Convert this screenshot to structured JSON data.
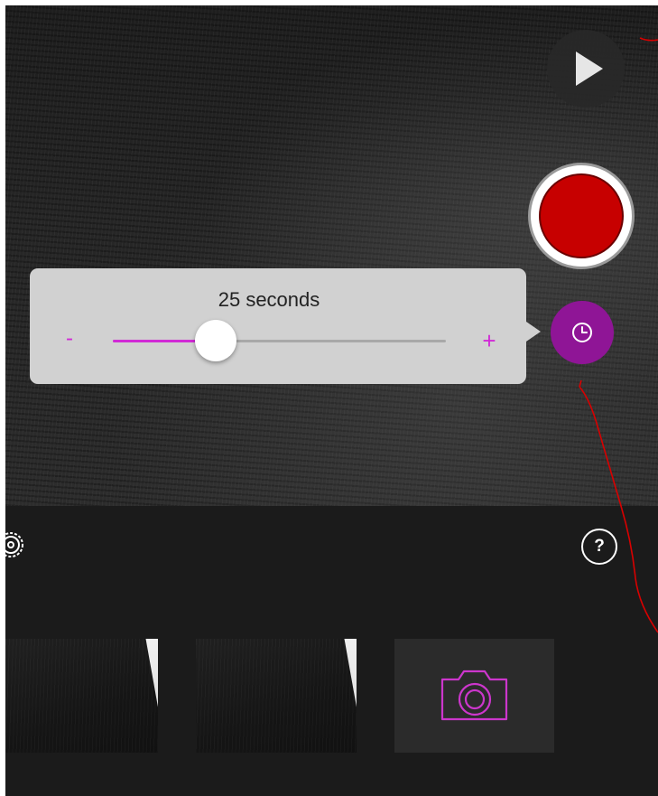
{
  "timer": {
    "duration_label": "25 seconds",
    "minus_label": "-",
    "plus_label": "+",
    "slider_fraction": 0.31
  },
  "help": {
    "label": "?"
  },
  "icons": {
    "play": "play-icon",
    "record": "record-icon",
    "timer": "clock-icon",
    "settings": "gear-icon",
    "help": "question-icon",
    "add_photo": "camera-icon"
  },
  "colors": {
    "accent": "#d12ad6",
    "timer_button": "#8f1596",
    "record": "#c70000",
    "popover": "#d1d1d1",
    "annotation": "#d80000"
  }
}
